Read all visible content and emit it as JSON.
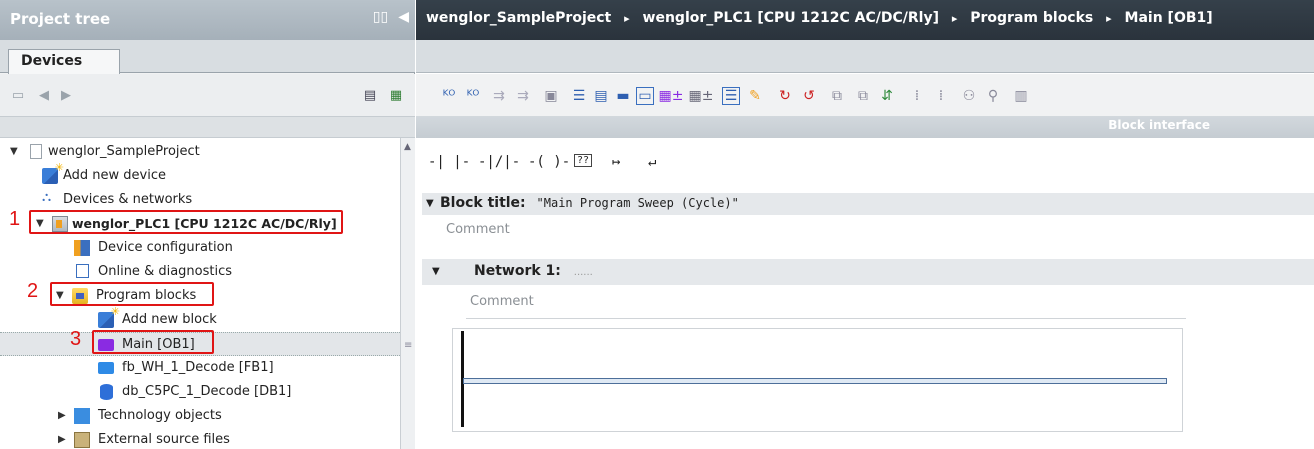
{
  "project_tree": {
    "title": "Project tree",
    "tab": "Devices",
    "items": [
      {
        "label": "wenglor_SampleProject"
      },
      {
        "label": "Add new device"
      },
      {
        "label": "Devices & networks"
      },
      {
        "label": "wenglor_PLC1 [CPU 1212C AC/DC/Rly]"
      },
      {
        "label": "Device configuration"
      },
      {
        "label": "Online & diagnostics"
      },
      {
        "label": "Program blocks"
      },
      {
        "label": "Add new block"
      },
      {
        "label": "Main [OB1]"
      },
      {
        "label": "fb_WH_1_Decode [FB1]"
      },
      {
        "label": "db_C5PC_1_Decode [DB1]"
      },
      {
        "label": "Technology objects"
      },
      {
        "label": "External source files"
      }
    ],
    "annotations": [
      "1",
      "2",
      "3"
    ],
    "highlight_color": "#e01515"
  },
  "breadcrumb": {
    "items": [
      "wenglor_SampleProject",
      "wenglor_PLC1 [CPU 1212C AC/DC/Rly]",
      "Program blocks",
      "Main [OB1]"
    ],
    "separator": "▸"
  },
  "editor": {
    "block_interface_label": "Block interface",
    "ladder_tools": [
      "-|  |-",
      "-|/|-",
      "-( )-",
      "??",
      "↦",
      "↵"
    ],
    "block_title_label": "Block title:",
    "block_title_value": "\"Main Program Sweep (Cycle)\"",
    "comment_placeholder": "Comment",
    "network_label": "Network 1:",
    "network_dots": "......",
    "network_comment": "Comment"
  }
}
